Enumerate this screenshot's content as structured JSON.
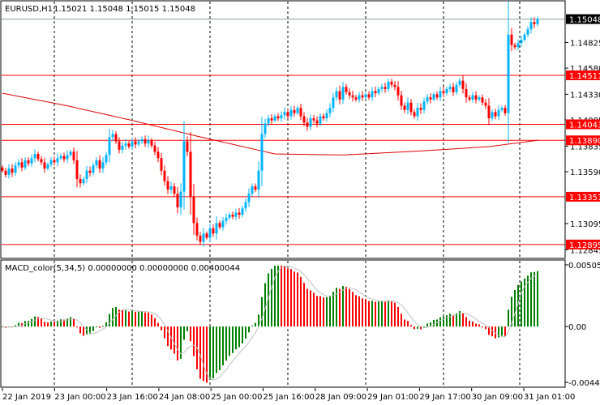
{
  "header": {
    "symbol": "EURUSD,H1",
    "ohlc": "1.15021 1.15048 1.15015 1.15048"
  },
  "macd_header": {
    "text": "MACD_color(5,34,5) 0.00000000 0.00000000 0.00400044"
  },
  "colors": {
    "bull": "#00b4ff",
    "bear": "#ff0000",
    "level": "#ff0000",
    "ma": "#dd0000",
    "macd_up": "#008000",
    "macd_down": "#ff0000",
    "signal": "#c0c0c0",
    "grid": "#000000"
  },
  "price_axis": {
    "range": [
      1.1277,
      1.15215
    ],
    "ticks": [
      "1.14825",
      "1.14580",
      "1.14330",
      "1.14085",
      "1.13835",
      "1.13590",
      "1.13095",
      "1.12845"
    ],
    "current": "1.15048"
  },
  "levels": [
    "1.14511",
    "1.14043",
    "1.13890",
    "1.13351",
    "1.12895"
  ],
  "macd_axis": {
    "top": "0.0050553",
    "zero": "0.00",
    "bottom": "-0.004499",
    "range": [
      -0.004499,
      0.0050553
    ]
  },
  "time_axis": [
    "22 Jan 2019",
    "23 Jan 00:00",
    "23 Jan 16:00",
    "24 Jan 08:00",
    "25 Jan 00:00",
    "25 Jan 16:00",
    "28 Jan 09:00",
    "29 Jan 01:00",
    "29 Jan 17:00",
    "30 Jan 09:00",
    "31 Jan 01:00"
  ],
  "chart_data": {
    "type": "candlestick",
    "title": "EURUSD,H1",
    "closes": [
      1.136,
      1.1356,
      1.1362,
      1.1358,
      1.1365,
      1.1368,
      1.1363,
      1.137,
      1.1367,
      1.1372,
      1.1376,
      1.1371,
      1.1368,
      1.1362,
      1.1366,
      1.137,
      1.1368,
      1.1372,
      1.1374,
      1.1371,
      1.1375,
      1.1378,
      1.137,
      1.1352,
      1.1348,
      1.1352,
      1.136,
      1.1358,
      1.1365,
      1.137,
      1.1362,
      1.1368,
      1.1375,
      1.1392,
      1.1395,
      1.1388,
      1.138,
      1.1384,
      1.1386,
      1.1383,
      1.1388,
      1.1385,
      1.1388,
      1.139,
      1.1386,
      1.1389,
      1.1384,
      1.1378,
      1.1372,
      1.136,
      1.135,
      1.1342,
      1.1345,
      1.1338,
      1.1325,
      1.134,
      1.1388,
      1.1378,
      1.1335,
      1.131,
      1.1298,
      1.1292,
      1.13,
      1.1296,
      1.1305,
      1.13,
      1.131,
      1.1306,
      1.1312,
      1.1315,
      1.1318,
      1.1316,
      1.132,
      1.1318,
      1.1324,
      1.133,
      1.1338,
      1.1345,
      1.1342,
      1.136,
      1.1395,
      1.1405,
      1.141,
      1.1408,
      1.1412,
      1.141,
      1.1413,
      1.1416,
      1.1412,
      1.1418,
      1.1415,
      1.142,
      1.1412,
      1.1406,
      1.1402,
      1.141,
      1.1408,
      1.1405,
      1.1412,
      1.141,
      1.1415,
      1.142,
      1.143,
      1.1436,
      1.1428,
      1.144,
      1.1435,
      1.1432,
      1.143,
      1.1428,
      1.1432,
      1.143,
      1.1433,
      1.143,
      1.1436,
      1.1434,
      1.1438,
      1.144,
      1.1438,
      1.1445,
      1.1442,
      1.144,
      1.1432,
      1.1422,
      1.1418,
      1.1425,
      1.1416,
      1.1412,
      1.142,
      1.1418,
      1.1426,
      1.143,
      1.1428,
      1.1433,
      1.143,
      1.1436,
      1.1434,
      1.1438,
      1.144,
      1.1435,
      1.1442,
      1.1446,
      1.1438,
      1.143,
      1.1428,
      1.1432,
      1.1428,
      1.143,
      1.1425,
      1.1422,
      1.141,
      1.1416,
      1.1412,
      1.1418,
      1.142,
      1.1415,
      1.149,
      1.148,
      1.1478,
      1.1482,
      1.1485,
      1.149,
      1.1495,
      1.1502,
      1.15,
      1.15048
    ],
    "moving_average": [
      [
        0,
        1.1434
      ],
      [
        20,
        1.1422
      ],
      [
        40,
        1.1408
      ],
      [
        60,
        1.1393
      ],
      [
        84,
        1.1376
      ],
      [
        105,
        1.1375
      ],
      [
        130,
        1.1379
      ],
      [
        150,
        1.1383
      ],
      [
        165,
        1.1389
      ]
    ],
    "macd": {
      "fast": 5,
      "slow": 34,
      "signal": 5
    }
  }
}
